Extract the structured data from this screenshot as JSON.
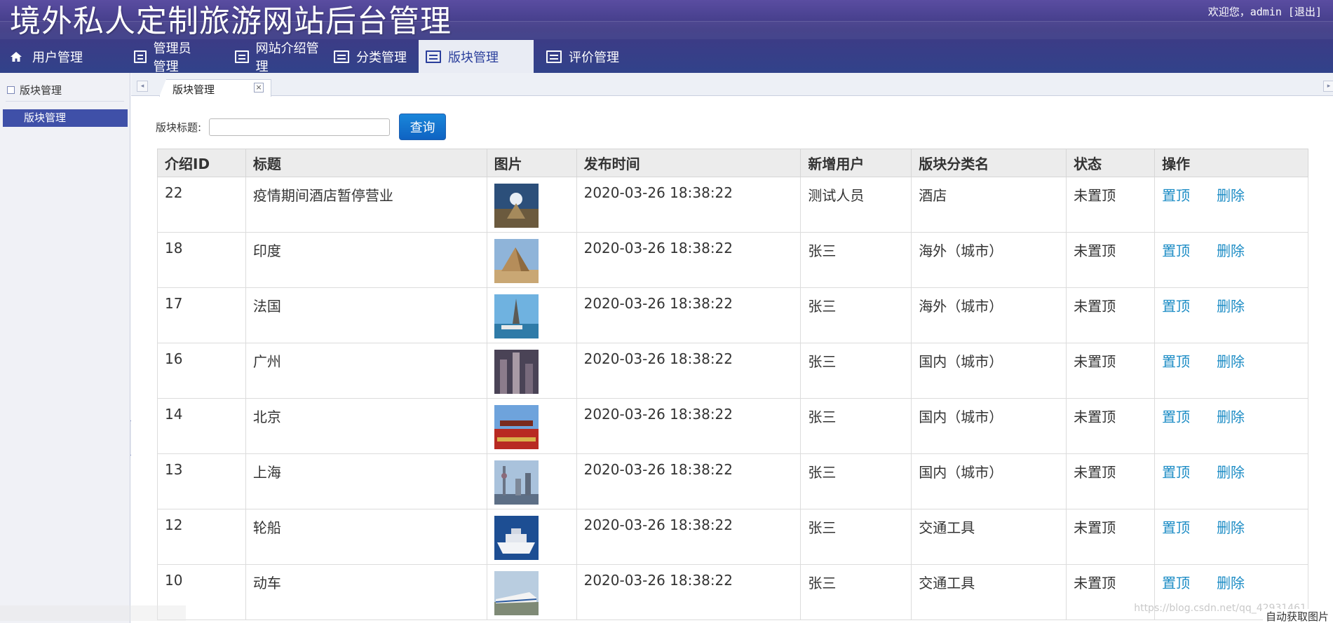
{
  "header": {
    "title": "境外私人定制旅游网站后台管理",
    "welcome": "欢迎您，admin [退出]"
  },
  "nav": {
    "items": [
      {
        "label": "用户管理",
        "icon": "home-icon"
      },
      {
        "label": "管理员管理",
        "icon": "list-icon"
      },
      {
        "label": "网站介绍管理",
        "icon": "list-icon"
      },
      {
        "label": "分类管理",
        "icon": "list-icon"
      },
      {
        "label": "版块管理",
        "icon": "list-icon",
        "active": true
      },
      {
        "label": "评价管理",
        "icon": "list-icon"
      }
    ]
  },
  "sidebar": {
    "heading": "版块管理",
    "items": [
      "版块管理"
    ]
  },
  "tabs": {
    "active_label": "版块管理"
  },
  "search": {
    "label": "版块标题:",
    "value": "",
    "button": "查询"
  },
  "table": {
    "headers": [
      "介绍ID",
      "标题",
      "图片",
      "发布时间",
      "新增用户",
      "版块分类名",
      "状态",
      "操作"
    ],
    "rows": [
      {
        "id": "22",
        "title": "疫情期间酒店暂停营业",
        "time": "2020-03-26 18:38:22",
        "user": "测试人员",
        "category": "酒店",
        "status": "未置顶",
        "op1": "置顶",
        "op2": "删除"
      },
      {
        "id": "18",
        "title": "印度",
        "time": "2020-03-26 18:38:22",
        "user": "张三",
        "category": "海外（城市）",
        "status": "未置顶",
        "op1": "置顶",
        "op2": "删除"
      },
      {
        "id": "17",
        "title": "法国",
        "time": "2020-03-26 18:38:22",
        "user": "张三",
        "category": "海外（城市）",
        "status": "未置顶",
        "op1": "置顶",
        "op2": "删除"
      },
      {
        "id": "16",
        "title": "广州",
        "time": "2020-03-26 18:38:22",
        "user": "张三",
        "category": "国内（城市）",
        "status": "未置顶",
        "op1": "置顶",
        "op2": "删除"
      },
      {
        "id": "14",
        "title": "北京",
        "time": "2020-03-26 18:38:22",
        "user": "张三",
        "category": "国内（城市）",
        "status": "未置顶",
        "op1": "置顶",
        "op2": "删除"
      },
      {
        "id": "13",
        "title": "上海",
        "time": "2020-03-26 18:38:22",
        "user": "张三",
        "category": "国内（城市）",
        "status": "未置顶",
        "op1": "置顶",
        "op2": "删除"
      },
      {
        "id": "12",
        "title": "轮船",
        "time": "2020-03-26 18:38:22",
        "user": "张三",
        "category": "交通工具",
        "status": "未置顶",
        "op1": "置顶",
        "op2": "删除"
      },
      {
        "id": "10",
        "title": "动车",
        "time": "2020-03-26 18:38:22",
        "user": "张三",
        "category": "交通工具",
        "status": "未置顶",
        "op1": "置顶",
        "op2": "删除"
      }
    ]
  },
  "watermark": "https://blog.csdn.net/qq_42931461",
  "footer_note": "自动获取图片",
  "colors": {
    "header": "#3f3a85",
    "accent": "#3f50a8",
    "link": "#1c8cc5",
    "button": "#0e63c2"
  }
}
